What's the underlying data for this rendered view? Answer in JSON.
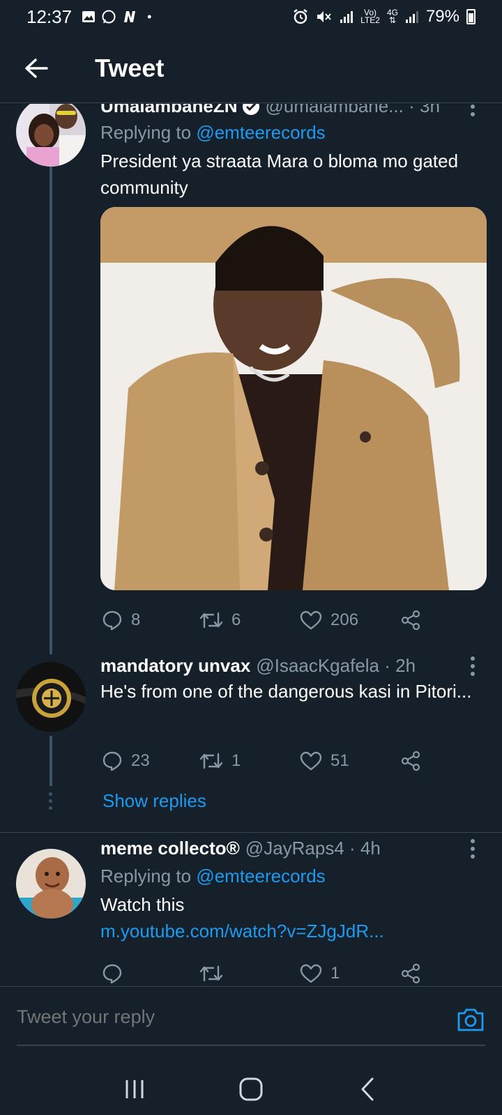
{
  "status_bar": {
    "time": "12:37",
    "volte": "Vo)",
    "lte": "LTE2",
    "network": "4G",
    "battery": "79%"
  },
  "header": {
    "title": "Tweet"
  },
  "tweets": [
    {
      "name": "UmalambaneZN",
      "handle": "@umalambane... · 3h",
      "replying_prefix": "Replying to",
      "replying_to": "@emteerecords",
      "text": "President ya straata Mara o bloma mo gated community",
      "replies": "8",
      "retweets": "6",
      "likes": "206"
    },
    {
      "name": "mandatory unvax",
      "handle": "@IsaacKgafela · 2h",
      "text": "He's from one of the dangerous kasi in Pitori...",
      "replies": "23",
      "retweets": "1",
      "likes": "51",
      "show_replies": "Show replies"
    },
    {
      "name": "meme collecto®",
      "handle": "@JayRaps4 · 4h",
      "replying_prefix": "Replying to",
      "replying_to": "@emteerecords",
      "text": "Watch this",
      "link": "m.youtube.com/watch?v=ZJgJdR...",
      "likes": "1"
    }
  ],
  "composer": {
    "placeholder": "Tweet your reply"
  },
  "colors": {
    "background": "#15202b",
    "accent": "#1d9bf0",
    "secondary_text": "#8899a6",
    "divider": "#38444d"
  }
}
